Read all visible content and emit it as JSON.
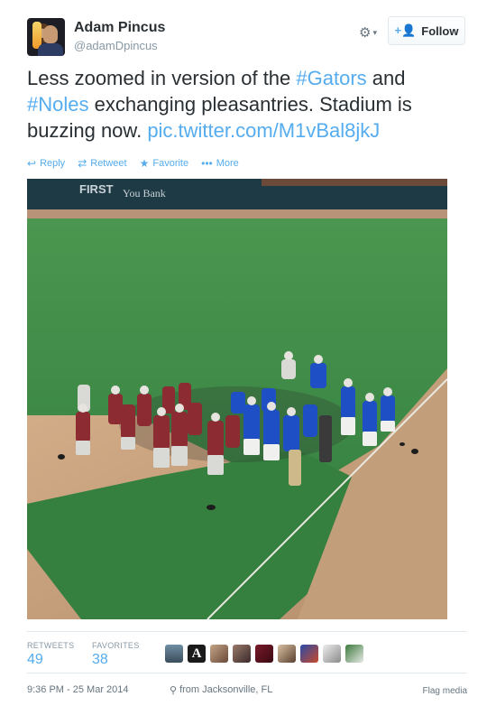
{
  "user": {
    "name": "Adam Pincus",
    "handle": "@adamDpincus"
  },
  "controls": {
    "gear": "⚙",
    "caret": "▾",
    "follow_label": "Follow",
    "follow_icon": "+👤"
  },
  "tweet": {
    "text_1": "Less zoomed in version of the ",
    "hashtag_1": "#Gators",
    "text_2": " and ",
    "hashtag_2": "#Noles",
    "text_3": " exchanging pleasantries. Stadium is buzzing now. ",
    "link": "pic.twitter.com/M1vBal8jkJ"
  },
  "actions": {
    "reply": "Reply",
    "retweet": "Retweet",
    "favorite": "Favorite",
    "more": "More"
  },
  "photo": {
    "wall_text_1": "FIRST",
    "wall_text_2": "You Bank"
  },
  "stats": {
    "retweets_label": "RETWEETS",
    "retweets_value": "49",
    "favorites_label": "FAVORITES",
    "favorites_value": "38"
  },
  "footer": {
    "time": "9:36 PM - 25 Mar 2014",
    "location": "from Jacksonville, FL",
    "flag": "Flag media"
  },
  "colors": {
    "link": "#55acee",
    "text": "#292f33",
    "muted": "#8899a6",
    "grass": "#3c8a45",
    "dirt": "#c7a27e",
    "wall": "#1e3a44",
    "maroon": "#8c2b32",
    "blue": "#1f4fc4"
  }
}
